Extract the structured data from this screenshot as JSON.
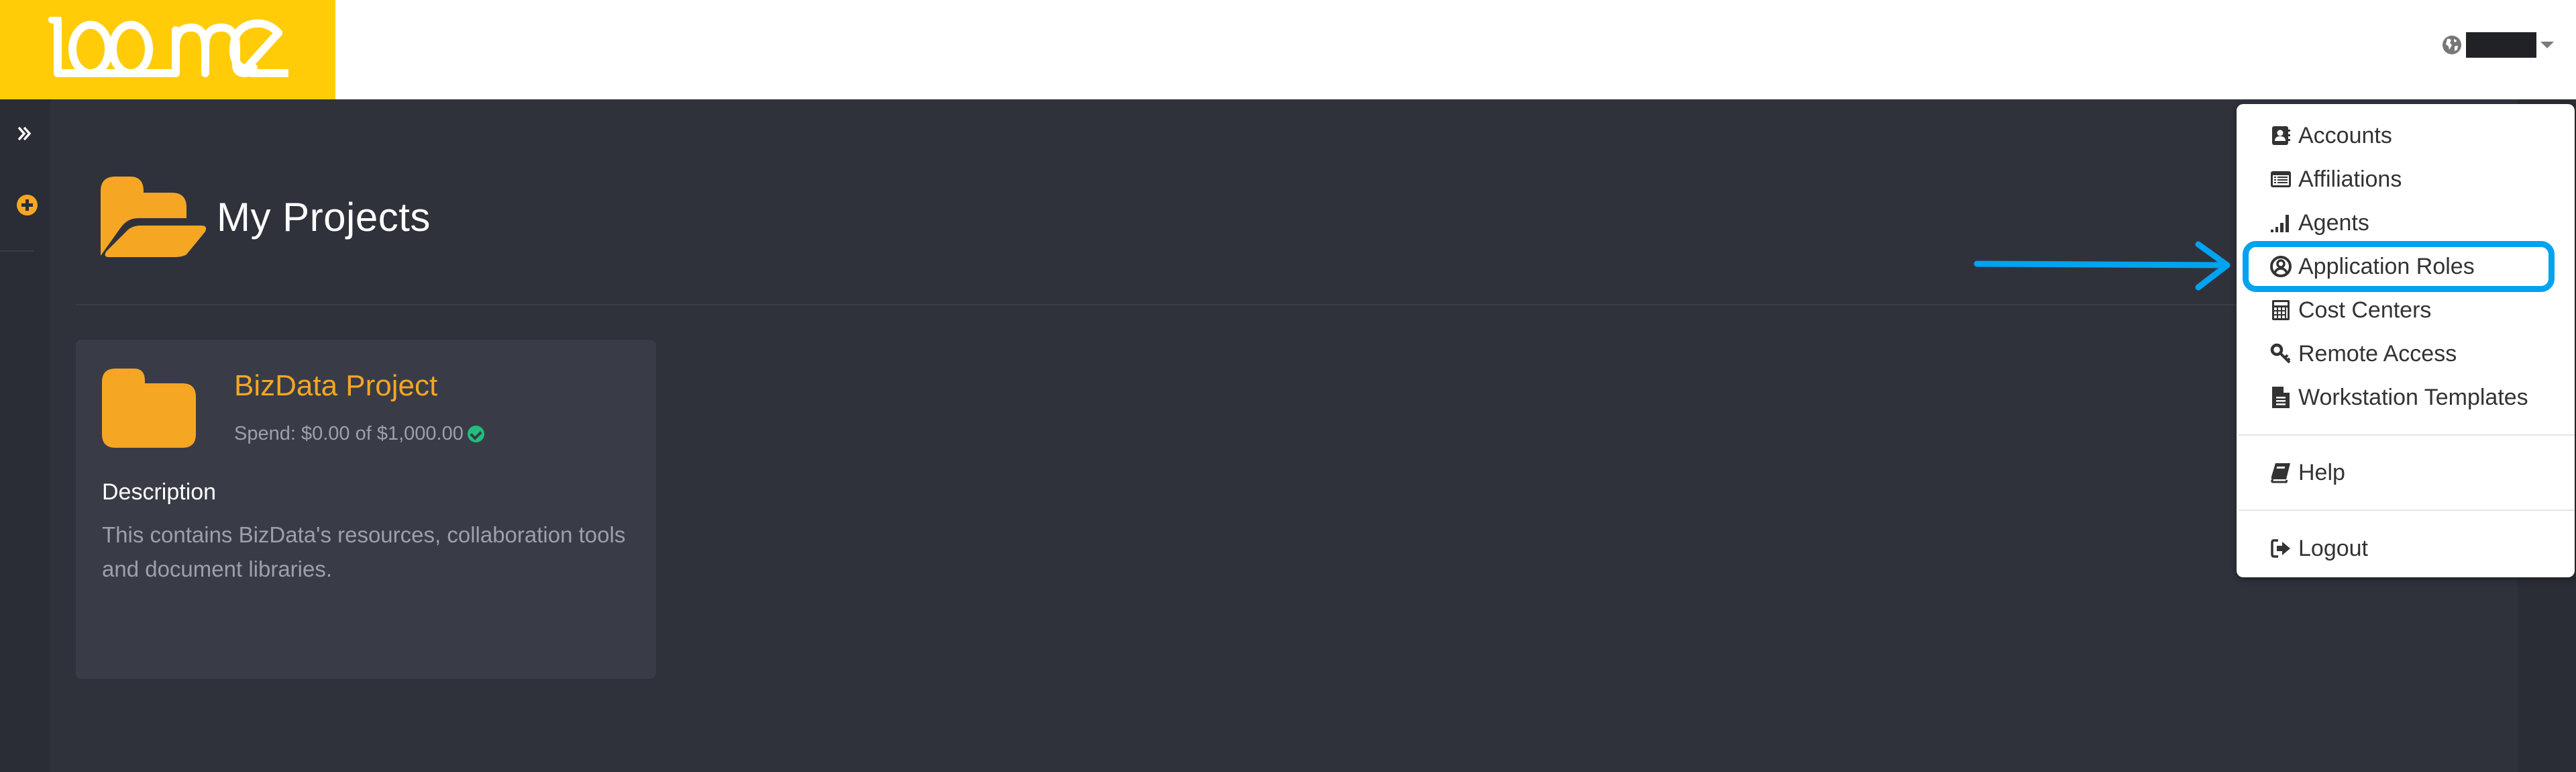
{
  "app": {
    "brand": "loome"
  },
  "header": {
    "user_name_redacted": true
  },
  "sidebar": {
    "expand_label": "»"
  },
  "page": {
    "title": "My Projects"
  },
  "projects": [
    {
      "name": "BizData Project",
      "spend": "Spend: $0.00 of $1,000.00",
      "spend_status": "ok",
      "description_label": "Description",
      "description": "This contains BizData's resources, collaboration tools and document libraries."
    }
  ],
  "user_dropdown": {
    "items": [
      {
        "label": "Accounts",
        "icon": "address-book-icon"
      },
      {
        "label": "Affiliations",
        "icon": "list-alt-icon"
      },
      {
        "label": "Agents",
        "icon": "signal-icon"
      },
      {
        "label": "Application Roles",
        "icon": "user-circle-icon",
        "highlighted": true
      },
      {
        "label": "Cost Centers",
        "icon": "calculator-icon"
      },
      {
        "label": "Remote Access",
        "icon": "key-icon"
      },
      {
        "label": "Workstation Templates",
        "icon": "file-text-icon"
      },
      {
        "label": "Help",
        "icon": "book-icon"
      },
      {
        "label": "Logout",
        "icon": "sign-out-icon"
      }
    ]
  },
  "colors": {
    "brand_yellow": "#ffcc07",
    "accent_orange": "#f5a623",
    "annotation_blue": "#00a3ef",
    "success_green": "#20bf7d"
  }
}
